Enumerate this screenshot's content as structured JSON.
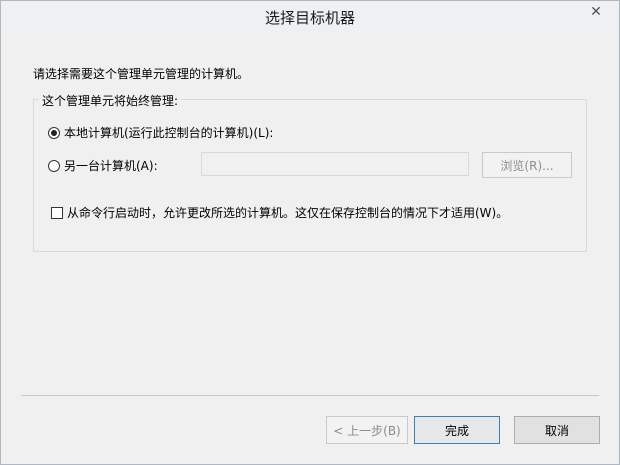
{
  "window": {
    "title": "选择目标机器",
    "close_glyph": "✕"
  },
  "intro_text": "请选择需要这个管理单元管理的计算机。",
  "group": {
    "legend": "这个管理单元将始终管理:",
    "option_local": {
      "label": "本地计算机(运行此控制台的计算机)(L):",
      "selected": true
    },
    "option_other": {
      "label": "另一台计算机(A):",
      "selected": false,
      "value": ""
    },
    "browse_label": "浏览(R)...",
    "cmdline_checkbox": {
      "label": "从命令行启动时，允许更改所选的计算机。这仅在保存控制台的情况下才适用(W)。",
      "checked": false
    }
  },
  "footer": {
    "back_label": "< 上一步(B)",
    "finish_label": "完成",
    "cancel_label": "取消"
  }
}
